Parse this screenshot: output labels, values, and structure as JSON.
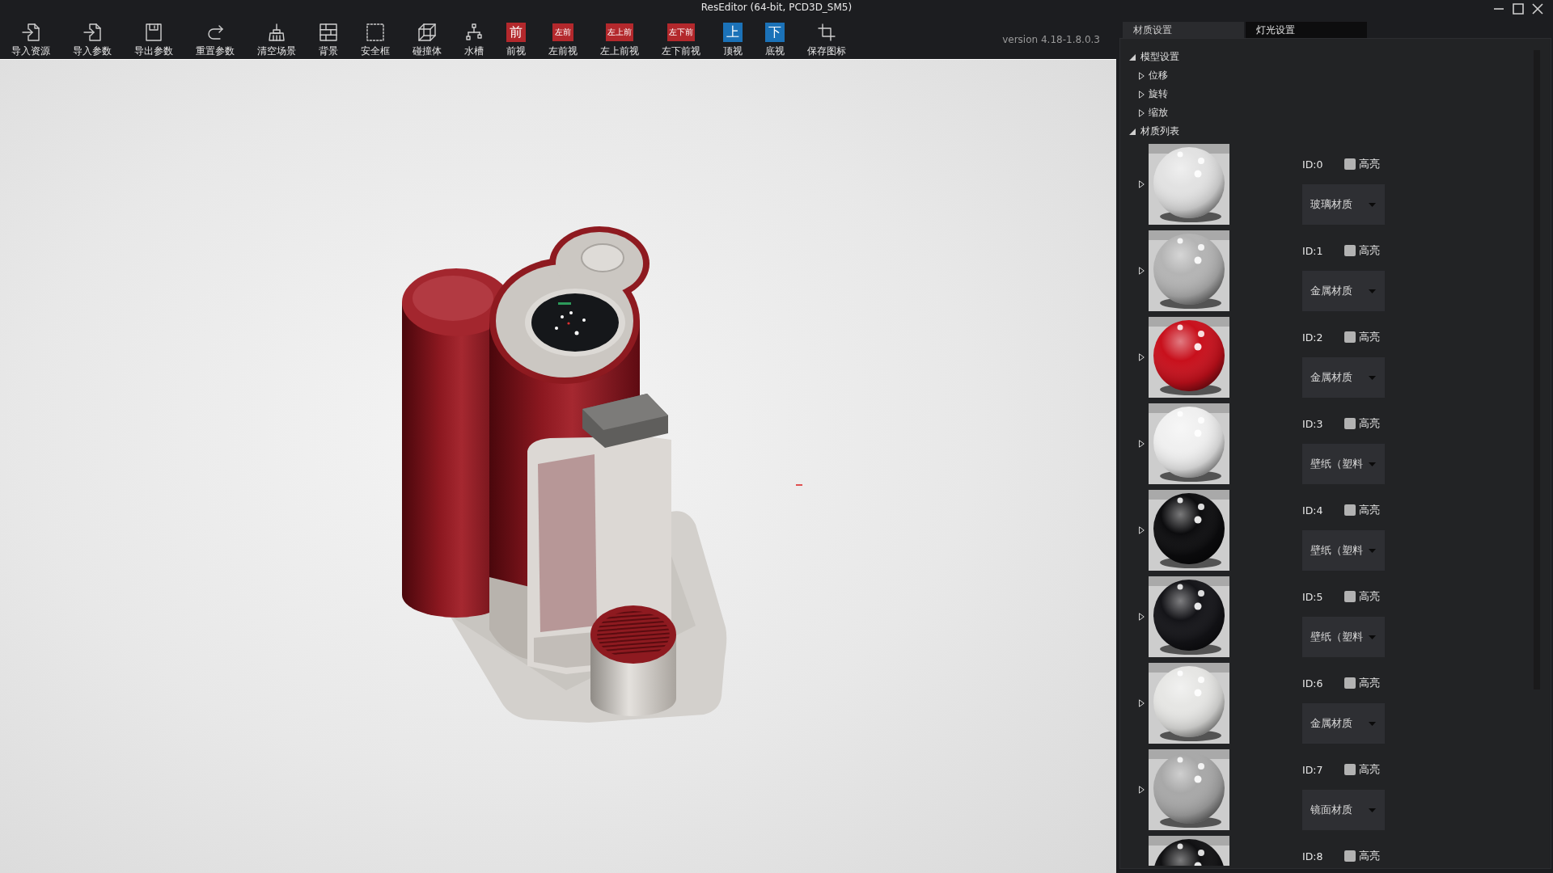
{
  "window": {
    "title": "ResEditor (64-bit, PCD3D_SM5)"
  },
  "toolbar": {
    "items": [
      {
        "kind": "tool",
        "label": "导入资源"
      },
      {
        "kind": "tool",
        "label": "导入参数"
      },
      {
        "kind": "tool",
        "label": "导出参数"
      },
      {
        "kind": "tool",
        "label": "重置参数"
      },
      {
        "kind": "tool",
        "label": "清空场景"
      },
      {
        "kind": "tool",
        "label": "背景"
      },
      {
        "kind": "tool",
        "label": "安全框"
      },
      {
        "kind": "tool",
        "label": "碰撞体"
      },
      {
        "kind": "tool",
        "label": "水槽"
      },
      {
        "kind": "view",
        "badge": "前",
        "color": "#b3282c",
        "label": "前视"
      },
      {
        "kind": "view",
        "badge": "左前",
        "color": "#b3282c",
        "label": "左前视"
      },
      {
        "kind": "view",
        "badge": "左上前",
        "color": "#b3282c",
        "label": "左上前视"
      },
      {
        "kind": "view",
        "badge": "左下前",
        "color": "#b3282c",
        "label": "左下前视"
      },
      {
        "kind": "view",
        "badge": "上",
        "color": "#1b72b8",
        "label": "顶视"
      },
      {
        "kind": "view",
        "badge": "下",
        "color": "#1b72b8",
        "label": "底视"
      },
      {
        "kind": "tool",
        "label": "保存图标"
      }
    ],
    "version": "version 4.18-1.8.0.3"
  },
  "panel": {
    "tabs": [
      {
        "label": "材质设置",
        "selected": true
      },
      {
        "label": "灯光设置",
        "selected": false
      }
    ],
    "tree": [
      {
        "kind": "node",
        "label": "模型设置",
        "expanded": true,
        "children": [
          {
            "kind": "node",
            "label": "位移",
            "expanded": false
          },
          {
            "kind": "node",
            "label": "旋转",
            "expanded": false
          },
          {
            "kind": "node",
            "label": "缩放",
            "expanded": false
          }
        ]
      },
      {
        "kind": "node",
        "label": "材质列表",
        "expanded": true,
        "children": [
          {
            "kind": "material",
            "id": "ID:0",
            "expanded": false,
            "color": "#e2e2e2",
            "checkbox": {
              "label": "高亮",
              "checked": false
            },
            "material": "玻璃材质"
          },
          {
            "kind": "material",
            "id": "ID:1",
            "expanded": false,
            "color": "#b4b4b4",
            "checkbox": {
              "label": "高亮",
              "checked": false
            },
            "material": "金属材质"
          },
          {
            "kind": "material",
            "id": "ID:2",
            "expanded": false,
            "color": "#c8101c",
            "checkbox": {
              "label": "高亮",
              "checked": false
            },
            "material": "金属材质"
          },
          {
            "kind": "material",
            "id": "ID:3",
            "expanded": false,
            "color": "#f0f0f0",
            "checkbox": {
              "label": "高亮",
              "checked": false
            },
            "material": "壁纸（塑料"
          },
          {
            "kind": "material",
            "id": "ID:4",
            "expanded": false,
            "color": "#0c0c0e",
            "checkbox": {
              "label": "高亮",
              "checked": false
            },
            "material": "壁纸（塑料"
          },
          {
            "kind": "material",
            "id": "ID:5",
            "expanded": false,
            "color": "#141418",
            "checkbox": {
              "label": "高亮",
              "checked": false
            },
            "material": "壁纸（塑料"
          },
          {
            "kind": "material",
            "id": "ID:6",
            "expanded": false,
            "color": "#e6e6e4",
            "checkbox": {
              "label": "高亮",
              "checked": false
            },
            "material": "金属材质"
          },
          {
            "kind": "material",
            "id": "ID:7",
            "expanded": false,
            "color": "#a8a8a8",
            "checkbox": {
              "label": "高亮",
              "checked": false
            },
            "material": "镜面材质"
          },
          {
            "kind": "material",
            "id": "ID:8",
            "color": "#101012",
            "checkbox": {
              "label": "高亮",
              "checked": false
            }
          }
        ]
      }
    ]
  }
}
